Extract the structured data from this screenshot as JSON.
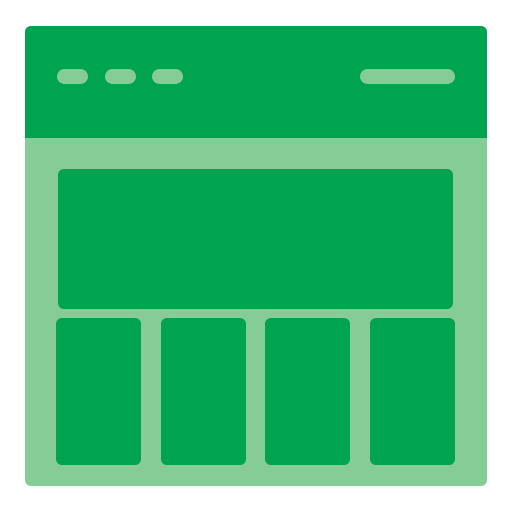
{
  "icon": {
    "name": "browser-window-layout-icon",
    "colors": {
      "primary": "#00a34f",
      "secondary": "#86cc96",
      "background": "#ffffff"
    },
    "titlebar": {
      "dot_count": 3,
      "has_address_bar": true
    },
    "content": {
      "hero_block_count": 1,
      "card_count": 4
    }
  }
}
